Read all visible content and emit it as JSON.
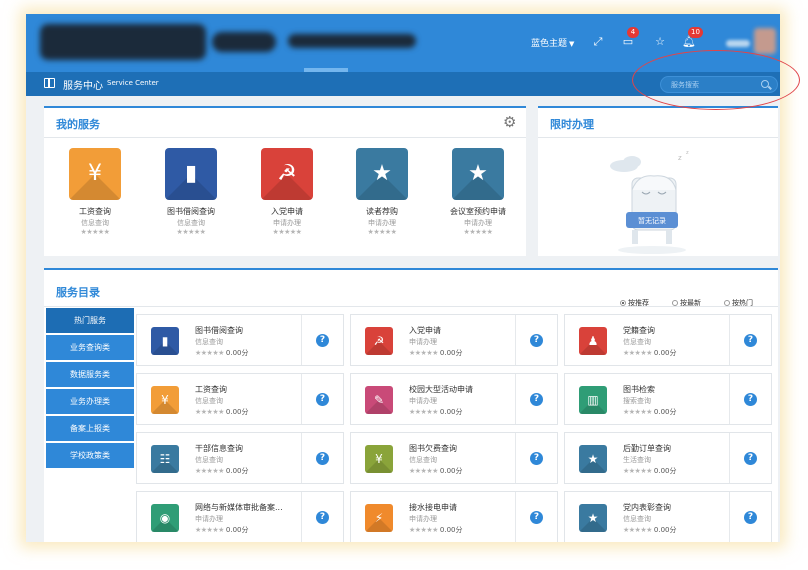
{
  "header": {
    "theme_menu": "蓝色主题",
    "messages_badge": "4",
    "notifications_badge": "10"
  },
  "service_bar": {
    "title": "服务中心",
    "subtitle": "Service Center",
    "search_placeholder": "服务搜索"
  },
  "my_services": {
    "title": "我的服务",
    "items": [
      {
        "name": "工资查询",
        "category": "信息查询",
        "color": "#f29d38",
        "glyph": "¥"
      },
      {
        "name": "图书借阅查询",
        "category": "信息查询",
        "color": "#2f5aa5",
        "glyph": "▮"
      },
      {
        "name": "入党申请",
        "category": "申请办理",
        "color": "#d9423a",
        "glyph": "☭"
      },
      {
        "name": "读者荐购",
        "category": "申请办理",
        "color": "#3a7aa0",
        "glyph": "★"
      },
      {
        "name": "会议室预约申请",
        "category": "申请办理",
        "color": "#3a7aa0",
        "glyph": "★"
      }
    ]
  },
  "limited": {
    "title": "限时办理",
    "empty_text": "暂无记录"
  },
  "catalog": {
    "title": "服务目录",
    "sort_options": [
      "按推荐",
      "按最新",
      "按热门"
    ],
    "sort_selected": "按推荐",
    "categories": [
      "热门服务",
      "业务查询类",
      "数据服务类",
      "业务办理类",
      "备案上报类",
      "学校政策类"
    ],
    "active_category": "热门服务",
    "items": [
      {
        "name": "图书借阅查询",
        "category": "信息查询",
        "score": "0.00分",
        "color": "#2f5aa5",
        "glyph": "▮"
      },
      {
        "name": "入党申请",
        "category": "申请办理",
        "score": "0.00分",
        "color": "#d9423a",
        "glyph": "☭"
      },
      {
        "name": "党籍查询",
        "category": "信息查询",
        "score": "0.00分",
        "color": "#d9423a",
        "glyph": "♟"
      },
      {
        "name": "工资查询",
        "category": "信息查询",
        "score": "0.00分",
        "color": "#f29d38",
        "glyph": "¥"
      },
      {
        "name": "校园大型活动申请",
        "category": "申请办理",
        "score": "0.00分",
        "color": "#c94a78",
        "glyph": "✎"
      },
      {
        "name": "图书检索",
        "category": "搜索查询",
        "score": "0.00分",
        "color": "#2f9d76",
        "glyph": "▥"
      },
      {
        "name": "干部信息查询",
        "category": "信息查询",
        "score": "0.00分",
        "color": "#3a7aa0",
        "glyph": "☷"
      },
      {
        "name": "图书欠费查询",
        "category": "信息查询",
        "score": "0.00分",
        "color": "#8aa43a",
        "glyph": "¥"
      },
      {
        "name": "后勤订单查询",
        "category": "生活查询",
        "score": "0.00分",
        "color": "#3a7aa0",
        "glyph": "★"
      },
      {
        "name": "网络与新媒体审批备案...",
        "category": "申请办理",
        "score": "0.00分",
        "color": "#2f9d76",
        "glyph": "◉"
      },
      {
        "name": "接水接电申请",
        "category": "申请办理",
        "score": "0.00分",
        "color": "#f08a2c",
        "glyph": "⚡"
      },
      {
        "name": "党内表彰查询",
        "category": "信息查询",
        "score": "0.00分",
        "color": "#3a7aa0",
        "glyph": "★"
      }
    ]
  },
  "icons": {
    "expand": "expand-icon",
    "messages": "message-icon",
    "favorites": "star-icon",
    "notifications": "bell-icon",
    "help": "?",
    "stars_glyph": "★★★★★"
  }
}
